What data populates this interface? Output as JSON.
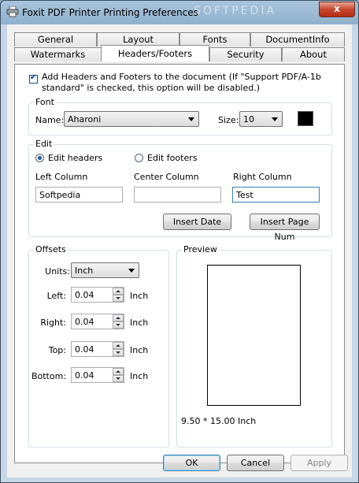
{
  "window": {
    "title": "Foxit PDF Printer Printing Preferences",
    "close_label": "x",
    "watermark": "SOFTPEDIA"
  },
  "tabs": {
    "back_row": [
      "General",
      "Layout",
      "Fonts",
      "DocumentInfo"
    ],
    "front_row": [
      "Watermarks",
      "Headers/Footers",
      "Security",
      "About"
    ],
    "active": "Headers/Footers"
  },
  "header_footer": {
    "enable_label": "Add Headers and Footers to the document (If \"Support PDF/A-1b standard\" is checked, this option will be disabled.)",
    "enable_label_line1": "Add Headers and Footers to the document (If \"Support PDF/A-1b",
    "enable_label_line2": "standard\" is checked, this option will be disabled.)",
    "enabled": true
  },
  "font": {
    "group_title": "Font",
    "name_label": "Name:",
    "name_value": "Aharoni",
    "size_label": "Size:",
    "size_value": "10",
    "color": "#000000"
  },
  "edit": {
    "group_title": "Edit",
    "edit_headers_label": "Edit headers",
    "edit_footers_label": "Edit footers",
    "selected": "headers",
    "left_column_label": "Left Column",
    "center_column_label": "Center Column",
    "right_column_label": "Right Column",
    "left_value": "Softpedia",
    "center_value": "",
    "right_value": "Test",
    "insert_date_label": "Insert Date",
    "insert_page_num_label": "Insert Page Num"
  },
  "offsets": {
    "group_title": "Offsets",
    "units_label": "Units:",
    "units_value": "Inch",
    "left_label": "Left:",
    "left_value": "0.04",
    "right_label": "Right:",
    "right_value": "0.04",
    "top_label": "Top:",
    "top_value": "0.04",
    "bottom_label": "Bottom:",
    "bottom_value": "0.04",
    "unit_suffix": "Inch"
  },
  "preview": {
    "group_title": "Preview",
    "size_text": "9.50 * 15.00 Inch"
  },
  "footer_buttons": {
    "ok_label": "OK",
    "cancel_label": "Cancel",
    "apply_label": "Apply"
  },
  "colors": {
    "accent": "#3c7fb1",
    "close_button": "#c8452e",
    "group_border": "#d5dfe5"
  }
}
